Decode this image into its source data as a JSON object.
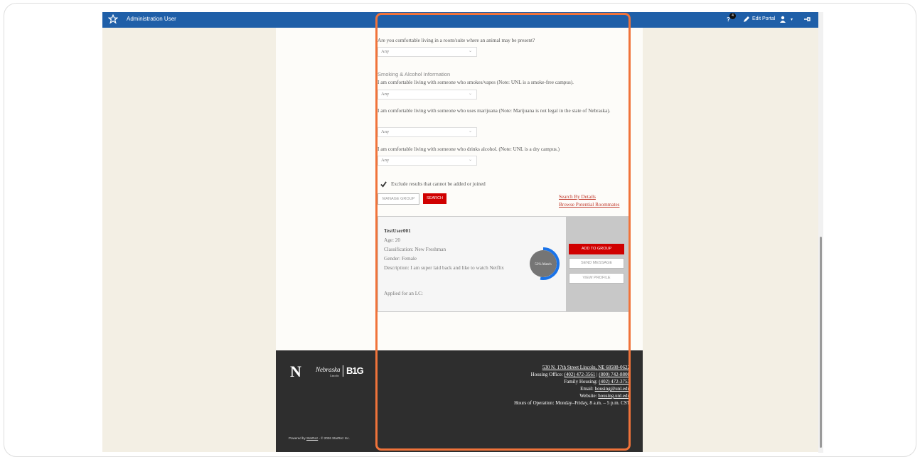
{
  "topbar": {
    "app_title": "Administration User",
    "help_label": "?",
    "notification_count": "4",
    "edit_portal": "Edit Portal",
    "caret": "▾"
  },
  "questions": {
    "animal": {
      "text": "Are you comfortable living in a room/suite where an animal may be present?",
      "value": "Any"
    },
    "section_heading": "Smoking & Alcohol Information",
    "smoke": {
      "text": "I am comfortable living with someone who smokes/vapes (Note: UNL is a smoke-free campus).",
      "value": "Any"
    },
    "marijuana": {
      "text": "I am comfortable living with someone who uses marijuana (Note: Marijuana is not legal in the state of Nebraska).",
      "value": "Any"
    },
    "alcohol": {
      "text": "I am comfortable living with someone who drinks alcohol. (Note: UNL is a dry campus.)",
      "value": "Any"
    }
  },
  "exclude_label": "Exclude results that cannot be added or joined",
  "buttons": {
    "manage_group": "MANAGE GROUP",
    "search": "SEARCH",
    "add_to_group": "ADD TO GROUP",
    "send_message": "SEND MESSAGE",
    "view_profile": "VIEW PROFILE"
  },
  "links": {
    "search_by_details": "Search By Details",
    "browse_roommates": "Browse Potential Roommates"
  },
  "result": {
    "name": "TestUser001",
    "age": "Age: 20",
    "classification": "Classification: New Freshman",
    "gender": "Gender: Female",
    "description": "Description: I am super laid back and like to watch Netflix",
    "lc": "Applied for an LC:",
    "match_label": "53% Match",
    "match_fraction": 0.53
  },
  "footer": {
    "address": "530 N. 17th Street Lincoln, NE 68588-0622",
    "housing_office_label": "Housing Office: ",
    "housing_office_phone1": "(402) 472-3561",
    "housing_office_sep": " | ",
    "housing_office_phone2": "(800) 742-8800",
    "family_label": "Family Housing: ",
    "family_phone": "(402) 472-3753",
    "email_label": "Email: ",
    "email": "housing@unl.edu",
    "website_label": "Website: ",
    "website": "housing.unl.edu",
    "hours": "Hours of Operation: Monday–Friday, 8 a.m. – 5 p.m. CST",
    "powered_prefix": "Powered by ",
    "powered_brand": "StarRez",
    "powered_suffix": " - © 2026 StarRez Inc.",
    "logo_n": "N",
    "logo_nebraska": "Nebraska",
    "logo_lincoln": "Lincoln",
    "logo_big": "B1G"
  },
  "colors": {
    "topbar": "#1f5fa8",
    "accent_red": "#d00000",
    "highlight": "#f0733a",
    "footer": "#2e2e2e",
    "match_ring": "#1a73e8"
  }
}
